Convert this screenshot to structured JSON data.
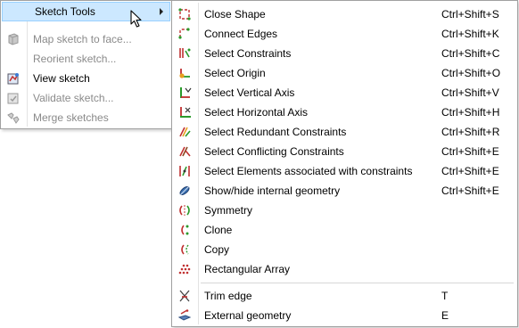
{
  "parent_menu": {
    "items": [
      {
        "label": "Sketch Tools",
        "icon": "sketch-tools-icon",
        "enabled": true,
        "highlighted": true,
        "has_submenu": true
      },
      {
        "label": "Map sketch to face...",
        "icon": "map-sketch-icon",
        "enabled": false
      },
      {
        "label": "Reorient sketch...",
        "icon": "",
        "enabled": false
      },
      {
        "label": "View sketch",
        "icon": "view-sketch-icon",
        "enabled": true
      },
      {
        "label": "Validate sketch...",
        "icon": "validate-sketch-icon",
        "enabled": false
      },
      {
        "label": "Merge sketches",
        "icon": "merge-sketches-icon",
        "enabled": false
      }
    ]
  },
  "sketch_tools_menu": {
    "items": [
      {
        "label": "Close Shape",
        "shortcut": "Ctrl+Shift+S",
        "icon": "close-shape-icon"
      },
      {
        "label": "Connect Edges",
        "shortcut": "Ctrl+Shift+K",
        "icon": "connect-edges-icon"
      },
      {
        "label": "Select Constraints",
        "shortcut": "Ctrl+Shift+C",
        "icon": "select-constraints-icon"
      },
      {
        "label": "Select Origin",
        "shortcut": "Ctrl+Shift+O",
        "icon": "select-origin-icon"
      },
      {
        "label": "Select Vertical Axis",
        "shortcut": "Ctrl+Shift+V",
        "icon": "select-vertical-axis-icon"
      },
      {
        "label": "Select Horizontal Axis",
        "shortcut": "Ctrl+Shift+H",
        "icon": "select-horizontal-axis-icon"
      },
      {
        "label": "Select Redundant Constraints",
        "shortcut": "Ctrl+Shift+R",
        "icon": "select-redundant-constraints-icon"
      },
      {
        "label": "Select Conflicting Constraints",
        "shortcut": "Ctrl+Shift+E",
        "icon": "select-conflicting-constraints-icon"
      },
      {
        "label": "Select Elements associated with constraints",
        "shortcut": "Ctrl+Shift+E",
        "icon": "select-elements-icon"
      },
      {
        "label": "Show/hide internal geometry",
        "shortcut": "Ctrl+Shift+E",
        "icon": "internal-geometry-icon"
      },
      {
        "label": "Symmetry",
        "shortcut": "",
        "icon": "symmetry-icon"
      },
      {
        "label": "Clone",
        "shortcut": "",
        "icon": "clone-icon"
      },
      {
        "label": "Copy",
        "shortcut": "",
        "icon": "copy-icon"
      },
      {
        "label": "Rectangular Array",
        "shortcut": "",
        "icon": "rectangular-array-icon"
      },
      {
        "label": "Trim edge",
        "shortcut": "T",
        "icon": "trim-edge-icon"
      },
      {
        "label": "External geometry",
        "shortcut": "E",
        "icon": "external-geometry-icon"
      }
    ]
  },
  "colors": {
    "highlight_bg": "#cce8ff",
    "highlight_border": "#99d1ff",
    "disabled_text": "#8a8a8a",
    "menu_border": "#a0a0a0"
  }
}
